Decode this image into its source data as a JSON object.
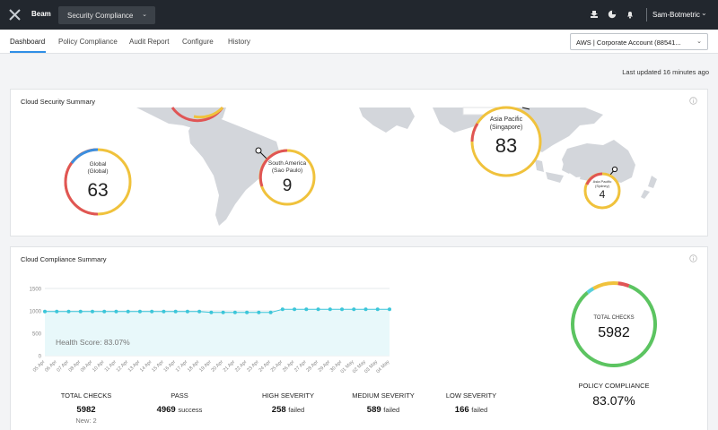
{
  "header": {
    "app_name": "Beam",
    "app_selector": "Security Compliance",
    "user_name": "Sam-Botmetric"
  },
  "nav": {
    "tabs": [
      {
        "label": "Dashboard",
        "active": true
      },
      {
        "label": "Policy Compliance",
        "active": false
      },
      {
        "label": "Audit Report",
        "active": false
      },
      {
        "label": "Configure",
        "active": false
      },
      {
        "label": "History",
        "active": false
      }
    ],
    "account_selector": "AWS | Corporate Account (88541..."
  },
  "last_updated": "Last updated 16 minutes ago",
  "security_summary": {
    "title": "Cloud Security Summary",
    "regions": [
      {
        "name": "Global",
        "sub": "(Global)",
        "count": "63"
      },
      {
        "name": "South America",
        "sub": "(Sao Paulo)",
        "count": "9"
      },
      {
        "name": "Asia Pacific",
        "sub": "(Singapore)",
        "count": "83"
      },
      {
        "name": "Asia Pacific",
        "sub": "(Sydney)",
        "count": "4"
      }
    ]
  },
  "compliance_summary": {
    "title": "Cloud Compliance Summary",
    "health_score": "Health Score: 83.07%",
    "donut": {
      "label": "TOTAL CHECKS",
      "value": "5982",
      "compliance_label": "POLICY COMPLIANCE",
      "compliance_value": "83.07%",
      "segments": [
        {
          "name": "pass",
          "fraction": 0.8307,
          "color": "#5cc461"
        },
        {
          "name": "low",
          "fraction": 0.0277,
          "color": "#5ad0d8"
        },
        {
          "name": "medium",
          "fraction": 0.0985,
          "color": "#f0c23c"
        },
        {
          "name": "high",
          "fraction": 0.0431,
          "color": "#e05555"
        }
      ]
    },
    "stats": [
      {
        "label": "TOTAL CHECKS",
        "value": "5982",
        "unit": "",
        "sub": "New: 2"
      },
      {
        "label": "PASS",
        "value": "4969",
        "unit": "success",
        "sub": ""
      },
      {
        "label": "HIGH SEVERITY",
        "value": "258",
        "unit": "failed",
        "sub": ""
      },
      {
        "label": "MEDIUM SEVERITY",
        "value": "589",
        "unit": "failed",
        "sub": ""
      },
      {
        "label": "LOW SEVERITY",
        "value": "166",
        "unit": "failed",
        "sub": ""
      }
    ]
  },
  "chart_data": {
    "type": "area",
    "categories": [
      "05 Apr",
      "06 Apr",
      "07 Apr",
      "08 Apr",
      "09 Apr",
      "10 Apr",
      "11 Apr",
      "12 Apr",
      "13 Apr",
      "14 Apr",
      "15 Apr",
      "16 Apr",
      "17 Apr",
      "18 Apr",
      "19 Apr",
      "20 Apr",
      "21 Apr",
      "22 Apr",
      "23 Apr",
      "24 Apr",
      "25 Apr",
      "26 Apr",
      "27 Apr",
      "28 Apr",
      "29 Apr",
      "30 Apr",
      "01 May",
      "02 May",
      "03 May",
      "04 May"
    ],
    "yticks": [
      "1500",
      "1000",
      "500",
      "0"
    ],
    "ylim": [
      0,
      1500
    ],
    "series": [
      {
        "values": [
          985,
          985,
          985,
          985,
          985,
          985,
          985,
          985,
          985,
          985,
          985,
          985,
          985,
          985,
          965,
          965,
          965,
          965,
          965,
          965,
          1035,
          1035,
          1035,
          1035,
          1035,
          1035,
          1035,
          1035,
          1035,
          1035
        ],
        "color": "#3cc6d9"
      }
    ],
    "grid": true
  }
}
